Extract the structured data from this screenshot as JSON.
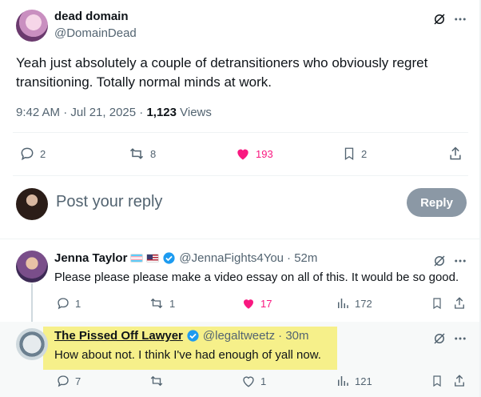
{
  "main_post": {
    "author_name": "dead domain",
    "author_handle": "@DomainDead",
    "text": "Yeah just absolutely a couple of detransitioners who obviously regret transitioning. Totally normal minds at work.",
    "timestamp": "9:42 AM · Jul 21, 2025 · ",
    "views_count": "1,123",
    "views_label": " Views",
    "stats": {
      "replies": "2",
      "reposts": "8",
      "likes": "193",
      "bookmarks": "2"
    },
    "like_color": "#f91880"
  },
  "reply_composer": {
    "placeholder": "Post your reply",
    "button_label": "Reply"
  },
  "replies": [
    {
      "author_name": "Jenna Taylor",
      "author_handle": "@JennaFights4You",
      "time": "· 52m",
      "text": "Please please please make a video essay on all of this. It would be so good.",
      "stats": {
        "replies": "1",
        "reposts": "1",
        "likes": "17",
        "views": "172"
      }
    },
    {
      "author_name": "The Pissed Off Lawyer",
      "author_handle": "@legaltweetz",
      "time": "· 30m",
      "text": "How about not. I think I've had enough of yall now.",
      "stats": {
        "replies": "7",
        "reposts": "",
        "likes": "1",
        "views": "121"
      }
    }
  ],
  "colors": {
    "accent": "#1d9bf0",
    "like": "#f91880",
    "highlight": "#f6f08a",
    "muted": "#536471"
  }
}
